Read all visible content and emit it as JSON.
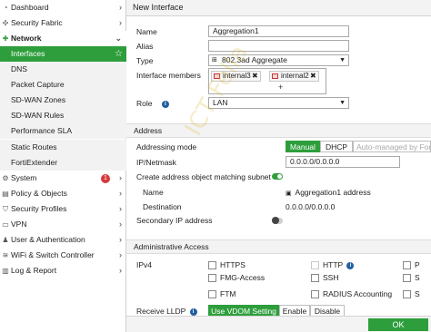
{
  "sidebar": {
    "items": [
      {
        "label": "Dashboard",
        "icon": "dashboard-icon",
        "glyph": "◔"
      },
      {
        "label": "Security Fabric",
        "icon": "fabric-icon",
        "glyph": "✣"
      },
      {
        "label": "Network",
        "icon": "network-icon",
        "glyph": "✚"
      },
      {
        "label": "Interfaces"
      },
      {
        "label": "DNS"
      },
      {
        "label": "Packet Capture"
      },
      {
        "label": "SD-WAN Zones"
      },
      {
        "label": "SD-WAN Rules"
      },
      {
        "label": "Performance SLA"
      },
      {
        "label": "Static Routes"
      },
      {
        "label": "FortiExtender"
      },
      {
        "label": "System",
        "icon": "system-icon",
        "glyph": "⚙",
        "badge": "1"
      },
      {
        "label": "Policy & Objects",
        "icon": "policy-icon",
        "glyph": "▤"
      },
      {
        "label": "Security Profiles",
        "icon": "shield-icon",
        "glyph": "⛉"
      },
      {
        "label": "VPN",
        "icon": "vpn-icon",
        "glyph": "▭"
      },
      {
        "label": "User & Authentication",
        "icon": "user-icon",
        "glyph": "♟"
      },
      {
        "label": "WiFi & Switch Controller",
        "icon": "wifi-icon",
        "glyph": "≋"
      },
      {
        "label": "Log & Report",
        "icon": "report-icon",
        "glyph": "▥"
      }
    ]
  },
  "main": {
    "title": "New Interface",
    "name_label": "Name",
    "name_value": "Aggregation1",
    "alias_label": "Alias",
    "alias_value": "",
    "type_label": "Type",
    "type_value": "802.3ad Aggregate",
    "members_label": "Interface members",
    "members": [
      "internal3",
      "internal2"
    ],
    "add_member": "+",
    "role_label": "Role",
    "role_value": "LAN",
    "address_section": "Address",
    "addressing_mode_label": "Addressing mode",
    "addressing_modes": [
      "Manual",
      "DHCP",
      "Auto-managed by Forti"
    ],
    "ip_label": "IP/Netmask",
    "ip_value": "0.0.0.0/0.0.0.0",
    "create_object_label": "Create address object matching subnet",
    "object_name_label": "Name",
    "object_name_value": "Aggregation1 address",
    "destination_label": "Destination",
    "destination_value": "0.0.0.0/0.0.0.0",
    "secondary_ip_label": "Secondary IP address",
    "admin_section": "Administrative Access",
    "ipv4_label": "IPv4",
    "access_col1": [
      "HTTPS",
      "FMG-Access",
      "FTM"
    ],
    "access_col2": [
      "HTTP",
      "SSH",
      "RADIUS Accounting"
    ],
    "access_col3": [
      "P",
      "S",
      "S"
    ],
    "lldp_label": "Receive LLDP",
    "lldp_options": [
      "Use VDOM Setting",
      "Enable",
      "Disable"
    ],
    "ok_label": "OK",
    "watermark": "ICT Fella"
  },
  "colors": {
    "accent": "#2e9e3c",
    "badge": "#d6383c",
    "info": "#1f5fa0"
  }
}
